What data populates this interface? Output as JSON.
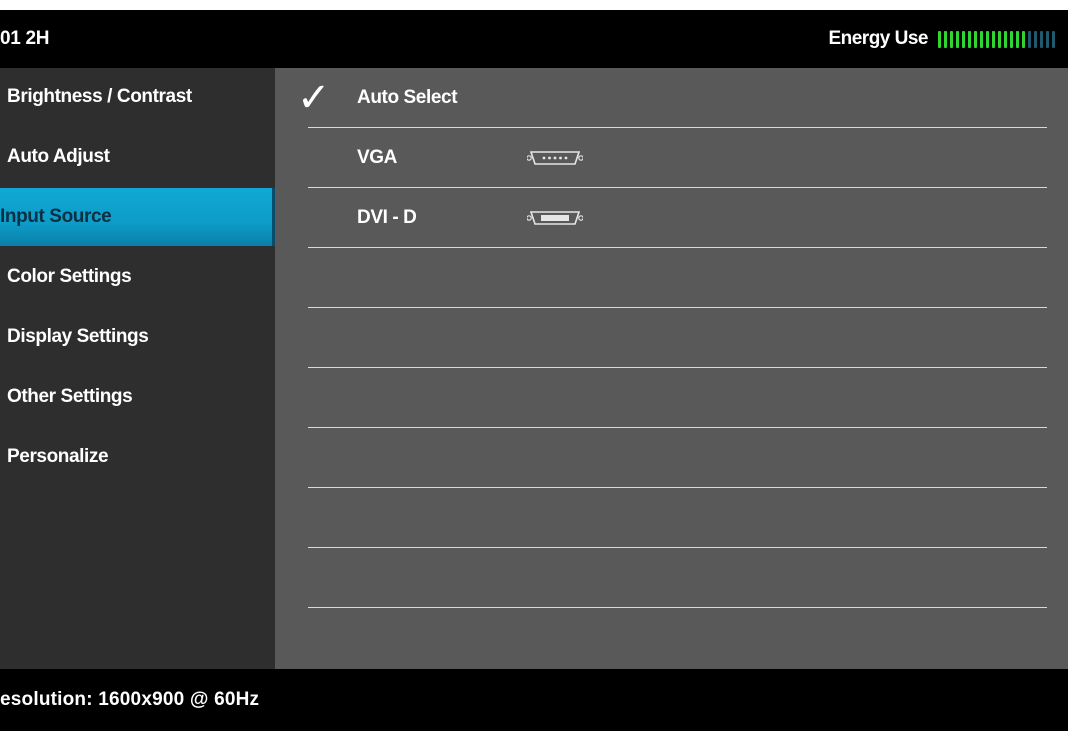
{
  "header": {
    "model": "01 2H",
    "energy_label": "Energy Use",
    "energy_segments_total": 20,
    "energy_segments_active": 15,
    "energy_active_color": "#2fd62f",
    "energy_inactive_color": "#1f5a6e"
  },
  "menu": {
    "items": [
      {
        "label": "Brightness / Contrast",
        "selected": false
      },
      {
        "label": "Auto Adjust",
        "selected": false
      },
      {
        "label": "Input Source",
        "selected": true
      },
      {
        "label": "Color Settings",
        "selected": false
      },
      {
        "label": "Display Settings",
        "selected": false
      },
      {
        "label": "Other Settings",
        "selected": false
      },
      {
        "label": "Personalize",
        "selected": false
      }
    ],
    "selected_color": "#0ea4d2"
  },
  "input_options": [
    {
      "label": "Auto Select",
      "checked": true,
      "connector": null
    },
    {
      "label": "VGA",
      "checked": false,
      "connector": "vga-connector-icon"
    },
    {
      "label": "DVI - D",
      "checked": false,
      "connector": "dvi-connector-icon"
    }
  ],
  "check_glyph": "✓",
  "empty_rows": 7,
  "footer": {
    "resolution": "esolution: 1600x900 @ 60Hz"
  }
}
